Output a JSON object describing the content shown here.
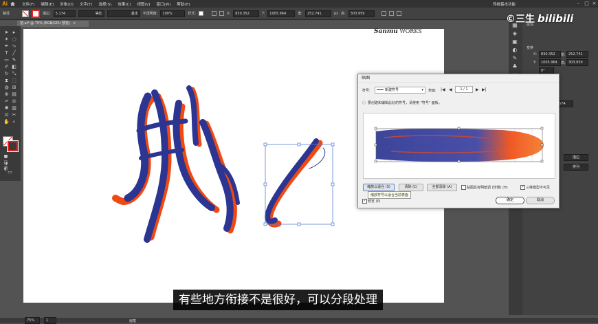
{
  "menu": {
    "logo": "Ai",
    "items": [
      "文件(F)",
      "编辑(E)",
      "对象(O)",
      "文字(T)",
      "选择(S)",
      "效果(C)",
      "视图(V)",
      "窗口(W)",
      "帮助(H)"
    ],
    "workspace": "传统基本功能"
  },
  "control_bar": {
    "selection_label": "路径",
    "stroke_label": "描边:",
    "stroke_value": "5.174",
    "profile_label": "等比",
    "brush_label": "基本",
    "opacity_label": "不透明度:",
    "opacity_value": "100%",
    "style_label": "样式:",
    "x_value": "830.352",
    "y_value": "1005.964",
    "w_value": "252.741",
    "h_value": "303.959",
    "unit": "px",
    "w_unit_label": "宽:",
    "h_unit_label": "高:"
  },
  "document_tab": {
    "title": "范.ai* @ 75% (RGB/GPU 预览)",
    "close": "×"
  },
  "brand": {
    "signature": "Sanmu",
    "suffix": "WORKS"
  },
  "watermark": {
    "text1": "©三生",
    "text2": "bilibili"
  },
  "dialog": {
    "title": "贴图",
    "symbol_label": "符号:",
    "symbol_value": "新建符号",
    "surface_label": "表面:",
    "surface_value": "1 / 1",
    "info_text": "要创建和编辑此处的符号，请使用 \"符号\" 面板。",
    "buttons": {
      "scale_to_fit": "缩放以适合 (S)",
      "clear": "清除 (C)",
      "clear_all": "全部清除 (A)",
      "ok": "确定",
      "cancel": "取消"
    },
    "shade_label": "贴图具有明暗调 (较慢) (H)",
    "invisible_label": "三维模型不可见",
    "preview_label": "预览 (P)",
    "tooltip": "缩放符号以适合当前表面"
  },
  "right_panel": {
    "tab_label": "属性",
    "section_transform": "变换",
    "x_label": "X:",
    "y_label": "Y:",
    "w_label": "宽:",
    "h_label": "高:",
    "x": "830.352",
    "y": "1005.964",
    "w": "252.741",
    "h": "303.959",
    "angle": "0°",
    "field_a": "574",
    "btn_a": "描边",
    "btn_b": "排列"
  },
  "status_bar": {
    "zoom": "75%",
    "page": "1",
    "mode": "画笔"
  },
  "subtitle": "有些地方衔接不是很好，可以分段处理",
  "colors": {
    "stroke_blue": "#2c3592",
    "stroke_orange": "#f04a12",
    "accent_red": "#e0261f"
  }
}
